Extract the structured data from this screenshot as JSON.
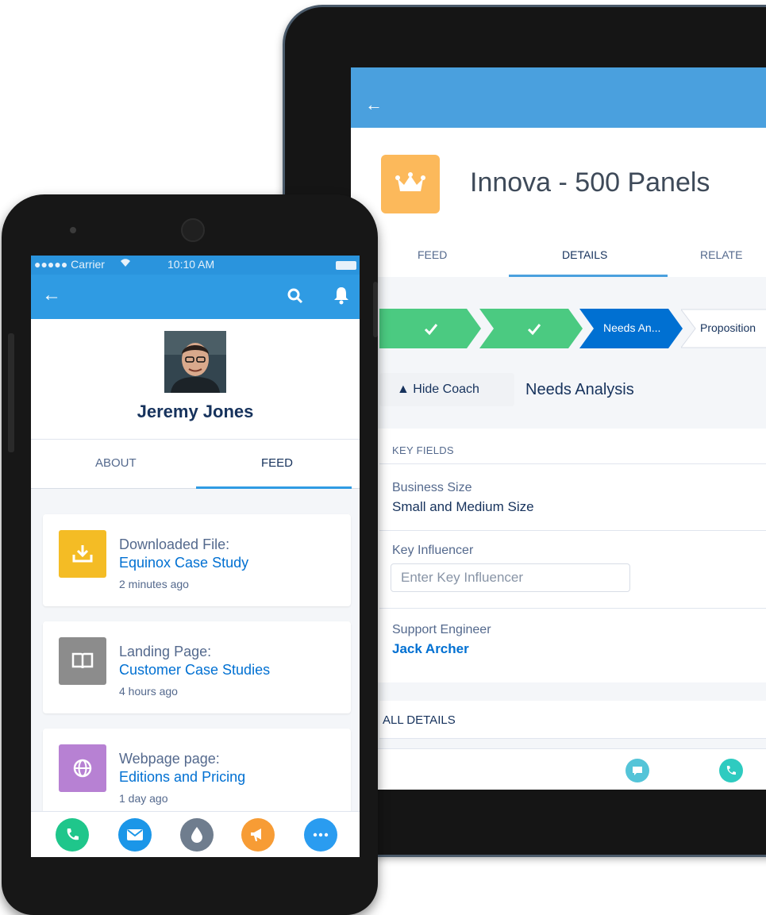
{
  "tablet": {
    "back_icon": "arrow-left-icon",
    "record": {
      "icon": "crown-icon",
      "icon_color": "#fcb95b",
      "title": "Innova - 500 Panels"
    },
    "tabs": [
      {
        "label": "FEED",
        "active": false
      },
      {
        "label": "DETAILS",
        "active": true
      },
      {
        "label": "RELATE",
        "active": false
      }
    ],
    "path": {
      "stages": [
        {
          "label": "",
          "status": "complete",
          "icon": "check-icon"
        },
        {
          "label": "",
          "status": "complete",
          "icon": "check-icon"
        },
        {
          "label": "Needs An...",
          "status": "current"
        },
        {
          "label": "Proposition",
          "status": "upcoming"
        }
      ],
      "complete_color": "#4bca81",
      "current_color": "#0070d2"
    },
    "coach": {
      "toggle_label": "▲ Hide Coach",
      "stage_name": "Needs Analysis"
    },
    "key_fields": {
      "heading": "KEY FIELDS",
      "business_size": {
        "label": "Business Size",
        "value": "Small and Medium Size"
      },
      "key_influencer": {
        "label": "Key Influencer",
        "placeholder": "Enter Key Influencer"
      },
      "support_engineer": {
        "label": "Support Engineer",
        "value": "Jack Archer"
      }
    },
    "all_details_label": "ALL DETAILS",
    "bottom_actions": [
      {
        "icon": "chat-icon",
        "color": "#54c4d8"
      },
      {
        "icon": "phone-call-icon",
        "color": "#2ecbc0"
      }
    ]
  },
  "phone": {
    "status_bar": {
      "carrier": "●●●●● Carrier",
      "wifi_icon": "wifi-icon",
      "time": "10:10 AM"
    },
    "back_icon": "arrow-left-icon",
    "search_icon": "search-icon",
    "bell_icon": "bell-icon",
    "profile": {
      "name": "Jeremy Jones"
    },
    "tabs": [
      {
        "label": "ABOUT",
        "active": false
      },
      {
        "label": "FEED",
        "active": true
      }
    ],
    "feed": [
      {
        "icon": "download-icon",
        "icon_color": "#f4bc25",
        "line1": "Downloaded File:",
        "line2": "Equinox Case Study",
        "time": "2 minutes ago"
      },
      {
        "icon": "book-icon",
        "icon_color": "#8c8c8c",
        "line1": "Landing Page:",
        "line2": "Customer Case Studies",
        "time": "4 hours ago"
      },
      {
        "icon": "globe-icon",
        "icon_color": "#b781d3",
        "line1": "Webpage page:",
        "line2": "Editions and Pricing",
        "time": "1 day ago"
      }
    ],
    "actions": [
      {
        "icon": "phone-icon",
        "color": "#1fc68b"
      },
      {
        "icon": "email-icon",
        "color": "#1b96e8"
      },
      {
        "icon": "drop-icon",
        "color": "#6f7d8e"
      },
      {
        "icon": "megaphone-icon",
        "color": "#f79c35"
      },
      {
        "icon": "more-icon",
        "color": "#2a9cf0"
      }
    ]
  }
}
